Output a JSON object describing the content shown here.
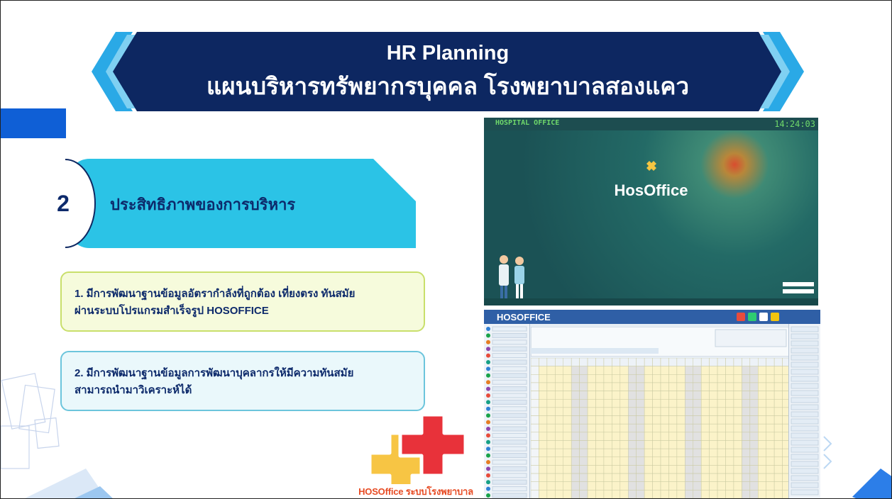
{
  "header": {
    "title_line1": "HR Planning",
    "title_line2": "แผนบริหารทรัพยากรบุคคล โรงพยาบาลสองแคว",
    "banner_color": "#0d2761",
    "chevron_color": "#2aa9e6"
  },
  "section": {
    "number": "2",
    "title": "ประสิทธิภาพของการบริหาร",
    "pill_color": "#2bc3e6"
  },
  "bullets": [
    {
      "line1": "1. มีการพัฒนาฐานข้อมูลอัตรากำลังที่ถูกต้อง เที่ยงตรง ทันสมัย",
      "line2": "ผ่านระบบโปรแกรมสำเร็จรูป HOSOFFICE"
    },
    {
      "line1": "2. มีการพัฒนาฐานข้อมูลการพัฒนาบุคลากรให้มีความทันสมัย",
      "line2": "สามารถนำมาวิเคราะห์ได้"
    }
  ],
  "logo": {
    "icon": "hosoffice-cross-logo",
    "caption": "HOSOffice ระบบโรงพยาบาล"
  },
  "screenshot_login": {
    "brand": "HOSPITAL OFFICE",
    "clock": "14:24:03",
    "app_name": "HosOffice"
  },
  "screenshot_app": {
    "brand": "HOSOFFICE"
  }
}
